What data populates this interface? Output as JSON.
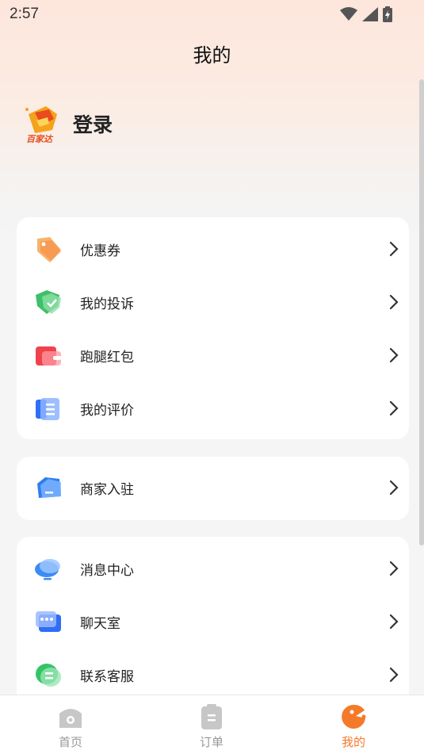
{
  "status_bar": {
    "time": "2:57"
  },
  "header": {
    "title": "我的"
  },
  "profile": {
    "login_label": "登录",
    "logo_text": "百家达"
  },
  "menu_card_1": [
    {
      "label": "优惠券",
      "icon": "coupon-icon"
    },
    {
      "label": "我的投诉",
      "icon": "complaint-shield-icon"
    },
    {
      "label": "跑腿红包",
      "icon": "red-packet-icon"
    },
    {
      "label": "我的评价",
      "icon": "review-icon"
    }
  ],
  "menu_card_2": [
    {
      "label": "商家入驻",
      "icon": "merchant-icon"
    }
  ],
  "menu_card_3": [
    {
      "label": "消息中心",
      "icon": "message-cloud-icon"
    },
    {
      "label": "聊天室",
      "icon": "chat-icon"
    },
    {
      "label": "联系客服",
      "icon": "customer-service-icon"
    }
  ],
  "tabbar": {
    "tabs": [
      {
        "label": "首页",
        "icon": "home-icon"
      },
      {
        "label": "订单",
        "icon": "order-icon"
      },
      {
        "label": "我的",
        "icon": "mine-icon",
        "active": true
      }
    ]
  },
  "colors": {
    "accent": "#f47a2a",
    "inactive": "#999999"
  }
}
